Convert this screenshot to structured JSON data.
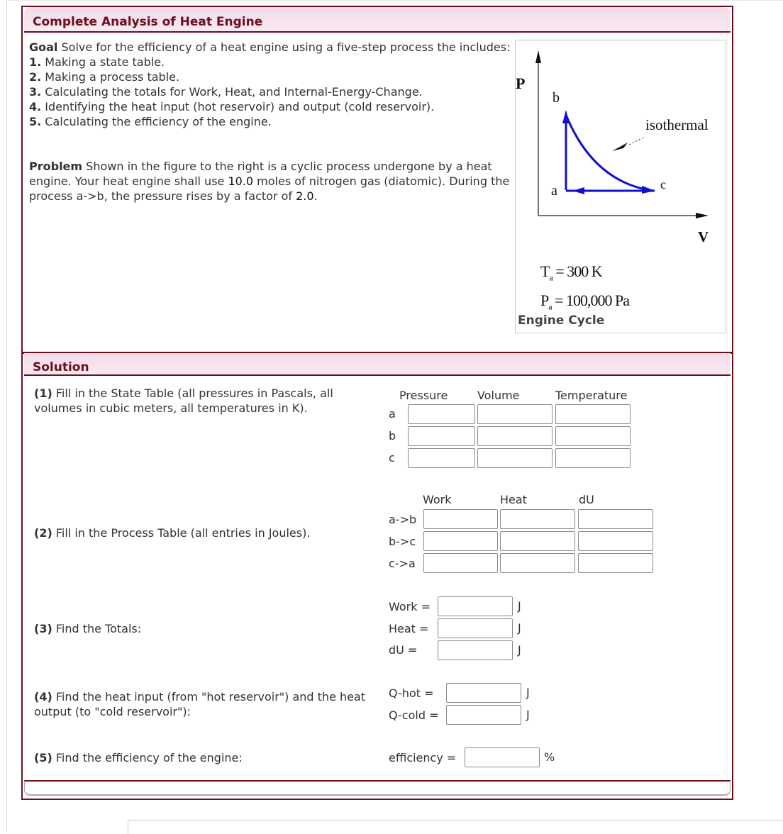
{
  "header": {
    "title": "Complete Analysis of Heat Engine"
  },
  "goal": {
    "label": "Goal",
    "text": " Solve for the efficiency of a heat engine using a five-step process the includes:",
    "steps": [
      {
        "num": "1.",
        "text": " Making a state table."
      },
      {
        "num": "2.",
        "text": " Making a process table."
      },
      {
        "num": "3.",
        "text": " Calculating the totals for Work, Heat, and Internal-Energy-Change."
      },
      {
        "num": "4.",
        "text": " Identifying the heat input (hot reservoir) and output (cold reservoir)."
      },
      {
        "num": "5.",
        "text": " Calculating the efficiency of the engine."
      }
    ]
  },
  "problem": {
    "label": "Problem",
    "text1": " Shown in the figure to the right is a cyclic process undergone by a heat engine. Your heat engine shall use ",
    "moles": "10.0",
    "text2": " moles of nitrogen gas (diatomic). During the process a->b, the pressure rises by a factor of ",
    "factor": "2.0",
    "text3": "."
  },
  "figure": {
    "axis_p": "P",
    "axis_v": "V",
    "point_a": "a",
    "point_b": "b",
    "point_c": "c",
    "isothermal": "isothermal",
    "ta_symbol": "T",
    "ta_sub": "a",
    "ta_value": "= 300 K",
    "pa_symbol": "P",
    "pa_sub": "a",
    "pa_value": "= 100,000 Pa",
    "caption": "Engine Cycle",
    "curve_color": "#1010cc"
  },
  "solution": {
    "title": "Solution",
    "step1": {
      "num": "(1)",
      "text": " Fill in the State Table (all pressures in Pascals, all volumes in cubic meters, all temperatures in K)."
    },
    "step2": {
      "num": "(2)",
      "text": " Fill in the Process Table (all entries in Joules)."
    },
    "step3": {
      "num": "(3)",
      "text": " Find the Totals:"
    },
    "step4": {
      "num": "(4)",
      "text": " Find the heat input (from \"hot reservoir\") and the heat output (to \"cold reservoir\"):"
    },
    "step5": {
      "num": "(5)",
      "text": " Find the efficiency of the engine:"
    },
    "state_table": {
      "columns": [
        "Pressure",
        "Volume",
        "Temperature"
      ],
      "rows": [
        {
          "label": "a",
          "values": [
            "",
            "",
            ""
          ]
        },
        {
          "label": "b",
          "values": [
            "",
            "",
            ""
          ]
        },
        {
          "label": "c",
          "values": [
            "",
            "",
            ""
          ]
        }
      ]
    },
    "process_table": {
      "columns": [
        "Work",
        "Heat",
        "dU"
      ],
      "rows": [
        {
          "label": "a->b",
          "values": [
            "",
            "",
            ""
          ]
        },
        {
          "label": "b->c",
          "values": [
            "",
            "",
            ""
          ]
        },
        {
          "label": "c->a",
          "values": [
            "",
            "",
            ""
          ]
        }
      ]
    },
    "totals": [
      {
        "label": "Work =",
        "value": "",
        "unit": "J"
      },
      {
        "label": "Heat =",
        "value": "",
        "unit": "J"
      },
      {
        "label": "dU =",
        "value": "",
        "unit": "J"
      }
    ],
    "reservoirs": [
      {
        "label": "Q-hot =",
        "value": "",
        "unit": "J"
      },
      {
        "label": "Q-cold =",
        "value": "",
        "unit": "J"
      }
    ],
    "efficiency": {
      "label": "efficiency =",
      "value": "",
      "unit": "%"
    }
  },
  "colors": {
    "accent": "#6b0f1d",
    "header_bg": "#f5e2ec"
  }
}
